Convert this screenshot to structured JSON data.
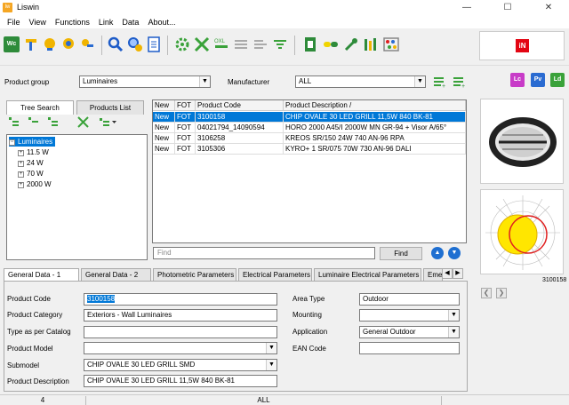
{
  "app": {
    "title": "Liswin",
    "logo_text": "lw"
  },
  "window_controls": {
    "minimize": "—",
    "maximize": "☐",
    "close": "✕"
  },
  "menu": [
    "File",
    "View",
    "Functions",
    "Link",
    "Data",
    "About..."
  ],
  "brand": {
    "logo_text": "iN"
  },
  "filters": {
    "product_group_label": "Product group",
    "product_group_value": "Luminaires",
    "manufacturer_label": "Manufacturer",
    "manufacturer_value": "ALL"
  },
  "side_buttons": {
    "lc": "Lc",
    "pv": "Pv",
    "ld": "Ld"
  },
  "left_tabs": {
    "tree_search": "Tree Search",
    "products_list": "Products List"
  },
  "tree": {
    "root": "Luminaires",
    "children": [
      "11.5 W",
      "24 W",
      "70 W",
      "2000 W"
    ]
  },
  "grid": {
    "headers": [
      "New",
      "FOT",
      "Product Code",
      "Product Description",
      "/"
    ],
    "rows": [
      [
        "New",
        "FOT",
        "3100158",
        "CHIP OVALE 30 LED GRILL 11,5W 840 BK-81"
      ],
      [
        "New",
        "FOT",
        "04021794_14090594",
        "HORO 2000 A45/I 2000W MN GR-94 + Visor A/65°"
      ],
      [
        "New",
        "FOT",
        "3106258",
        "KREOS SR/150 24W 740 AN-96 RPA"
      ],
      [
        "New",
        "FOT",
        "3105306",
        "KYRO+ 1 SR/075 70W 730 AN-96 DALI"
      ]
    ],
    "selected_row": 0
  },
  "find": {
    "placeholder": "Find",
    "button": "Find",
    "up_icon": "▲",
    "down_icon": "▼"
  },
  "preview": {
    "code": "3100158"
  },
  "nav": {
    "prev": "❮",
    "next": "❯"
  },
  "detail_tabs": [
    "General Data - 1",
    "General Data - 2",
    "Photometric Parameters",
    "Electrical Parameters",
    "Luminaire Electrical Parameters",
    "Emerge"
  ],
  "detail": {
    "product_code_label": "Product Code",
    "product_code": "3100158",
    "product_category_label": "Product Category",
    "product_category": "Exteriors - Wall Luminaires",
    "type_catalog_label": "Type as per Catalog",
    "type_catalog": "",
    "product_model_label": "Product Model",
    "product_model": "",
    "submodel_label": "Submodel",
    "submodel": "CHIP OVALE 30 LED GRILL SMD",
    "product_description_label": "Product Description",
    "product_description": "CHIP OVALE 30 LED GRILL 11,5W 840 BK-81",
    "area_type_label": "Area Type",
    "area_type": "Outdoor",
    "mounting_label": "Mounting",
    "mounting": "",
    "application_label": "Application",
    "application": "General Outdoor",
    "ean_code_label": "EAN Code",
    "ean_code": ""
  },
  "status": {
    "count": "4",
    "filter": "ALL"
  },
  "colors": {
    "selection": "#0078d7",
    "brand_red": "#e30613",
    "polar_yellow": "#ffe600",
    "polar_red": "#e02020"
  }
}
